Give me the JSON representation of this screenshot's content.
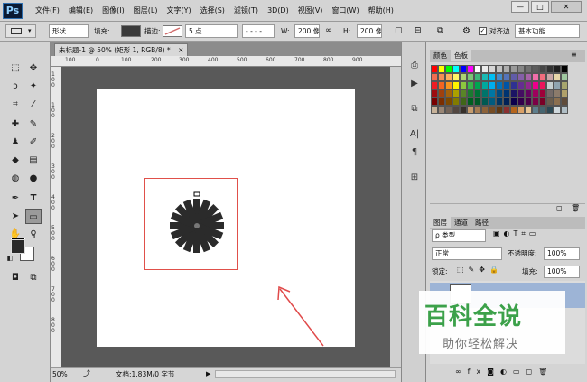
{
  "app": {
    "logo": "Ps"
  },
  "menu": [
    "文件(F)",
    "编辑(E)",
    "图像(I)",
    "图层(L)",
    "文字(Y)",
    "选择(S)",
    "滤镜(T)",
    "3D(D)",
    "视图(V)",
    "窗口(W)",
    "帮助(H)"
  ],
  "window_controls": {
    "minimize": "—",
    "maximize": "□",
    "close": "✕"
  },
  "options": {
    "mode": "形状",
    "fill_label": "填充:",
    "stroke_label": "描边:",
    "stroke_size": "5 点",
    "w_label": "W:",
    "w_value": "200 像",
    "h_label": "H:",
    "h_value": "200 像",
    "align_label": "对齐边",
    "workspace": "基本功能",
    "colors": {
      "fill": "#3a3a3a",
      "stroke": "#d06a6a"
    }
  },
  "document": {
    "tab_title": "未标题-1 @ 50% (矩形 1, RGB/8) *",
    "tab_close": "×",
    "zoom": "50%",
    "doc_info": "文档:1.83M/0 字节",
    "ruler_h": [
      "100",
      "0",
      "100",
      "200",
      "300",
      "400",
      "500",
      "600",
      "700",
      "800",
      "900"
    ],
    "ruler_v": [
      "1",
      "0",
      "0",
      "1",
      "0",
      "0",
      "2",
      "0",
      "0",
      "3",
      "0",
      "0",
      "4",
      "0",
      "0",
      "5",
      "0",
      "0",
      "6",
      "0",
      "0",
      "7",
      "0",
      "0",
      "8",
      "0",
      "0"
    ]
  },
  "panels": {
    "swatch_tabs": [
      "颜色",
      "色板"
    ],
    "layer_tabs": [
      "图层",
      "通道",
      "路径"
    ],
    "kind_filter": "ρ 类型",
    "blend_mode": "正常",
    "opacity_label": "不透明度:",
    "opacity_value": "100%",
    "lock_label": "锁定:",
    "fill_label": "填充:",
    "fill_value": "100%"
  },
  "watermark": {
    "title": "百科全说",
    "subtitle": "助你轻松解决"
  },
  "swatch_colors": [
    "#ff0000",
    "#ffff00",
    "#00ff00",
    "#00ffff",
    "#0000ff",
    "#ff00ff",
    "#ffffff",
    "#ebebeb",
    "#d6d6d6",
    "#c2c2c2",
    "#adadad",
    "#999999",
    "#858585",
    "#707070",
    "#5c5c5c",
    "#474747",
    "#333333",
    "#1f1f1f",
    "#000000",
    "#f26c4f",
    "#f68e55",
    "#fbaf5c",
    "#fff467",
    "#acd372",
    "#7cc576",
    "#3bb878",
    "#1abbb4",
    "#00bff3",
    "#438ccb",
    "#5574b9",
    "#605ca8",
    "#855fa8",
    "#a763a8",
    "#f06ea9",
    "#f26d7d",
    "#c9a6a6",
    "#e8d7a9",
    "#a0c8a0",
    "#ed1c24",
    "#f26522",
    "#f7941d",
    "#fff200",
    "#8dc73f",
    "#39b54a",
    "#00a651",
    "#00a99d",
    "#00aeef",
    "#0072bc",
    "#0054a6",
    "#2e3192",
    "#662d91",
    "#92278f",
    "#ec008c",
    "#ed145b",
    "#c4cfd0",
    "#8ea4b0",
    "#a7a56e",
    "#9e0b0f",
    "#a0410d",
    "#a3620a",
    "#aba000",
    "#598527",
    "#1a7b30",
    "#007236",
    "#00746b",
    "#0076a3",
    "#004b80",
    "#003471",
    "#1b1464",
    "#440e62",
    "#630460",
    "#9e005d",
    "#9e0039",
    "#746a68",
    "#8c7b6b",
    "#b0a06a",
    "#790000",
    "#7b2e00",
    "#7d4900",
    "#827b00",
    "#406618",
    "#005e20",
    "#005826",
    "#005952",
    "#005b7f",
    "#003663",
    "#002157",
    "#0d004c",
    "#32004b",
    "#4b0049",
    "#7b0046",
    "#7a0026",
    "#6b5e4e",
    "#8b6f4f",
    "#5f4b3a",
    "#c7b299",
    "#998675",
    "#736357",
    "#534741",
    "#37302a",
    "#c69c6d",
    "#a67c52",
    "#8c6239",
    "#754c24",
    "#603913",
    "#8a2f2f",
    "#b5651d",
    "#d9a066",
    "#e7c595",
    "#5e7e8c",
    "#466570",
    "#2d4a55",
    "#cfd8dc",
    "#b0bec5"
  ]
}
